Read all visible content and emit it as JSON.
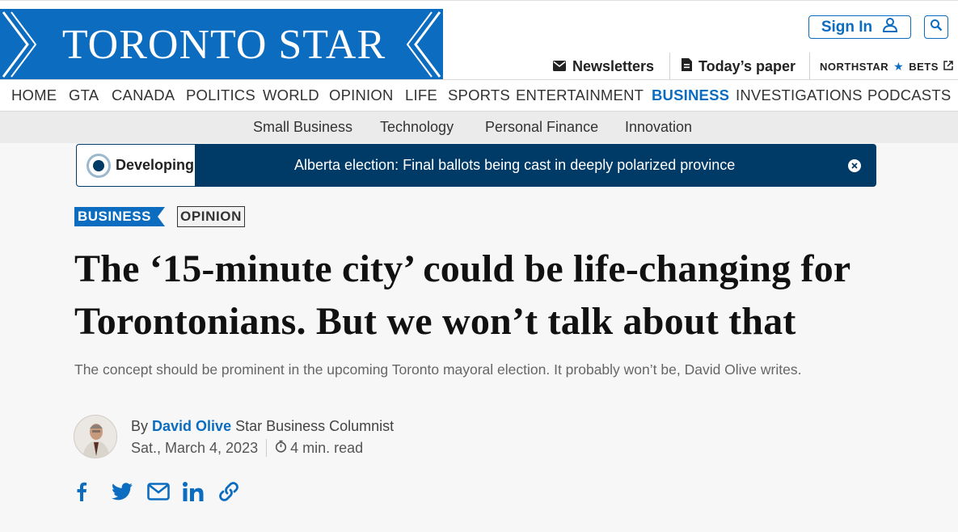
{
  "header": {
    "logo_text": "TORONTO STAR",
    "sign_in_label": "Sign In",
    "newsletters_label": "Newsletters",
    "todays_paper_label": "Today’s paper",
    "northstar_label": "NORTHSTAR",
    "bets_label": "BETS"
  },
  "nav": {
    "items": [
      "HOME",
      "GTA",
      "CANADA",
      "POLITICS",
      "WORLD",
      "OPINION",
      "LIFE",
      "SPORTS",
      "ENTERTAINMENT",
      "BUSINESS",
      "INVESTIGATIONS",
      "PODCASTS"
    ],
    "active": "BUSINESS"
  },
  "subnav": {
    "items": [
      "Small Business",
      "Technology",
      "Personal Finance",
      "Innovation"
    ]
  },
  "banner": {
    "label": "Developing",
    "text": "Alberta election: Final ballots being cast in deeply polarized province"
  },
  "article": {
    "section_tag": "BUSINESS",
    "type_tag": "OPINION",
    "headline": "The ‘15-minute city’ could be life-changing for Torontonians. But we won’t talk about that",
    "dek": "The concept should be prominent in the upcoming Toronto mayoral election. It probably won’t be, David Olive writes.",
    "byline_prefix": "By",
    "author": "David Olive",
    "author_title": "Star Business Columnist",
    "date": "Sat., March 4, 2023",
    "read_time": "4 min. read"
  },
  "share": {
    "icons": [
      "facebook-icon",
      "twitter-icon",
      "email-icon",
      "linkedin-icon",
      "link-icon"
    ]
  },
  "colors": {
    "brand_blue": "#0b6cc0",
    "banner_navy": "#003a66",
    "background": "#f7f7f7"
  }
}
